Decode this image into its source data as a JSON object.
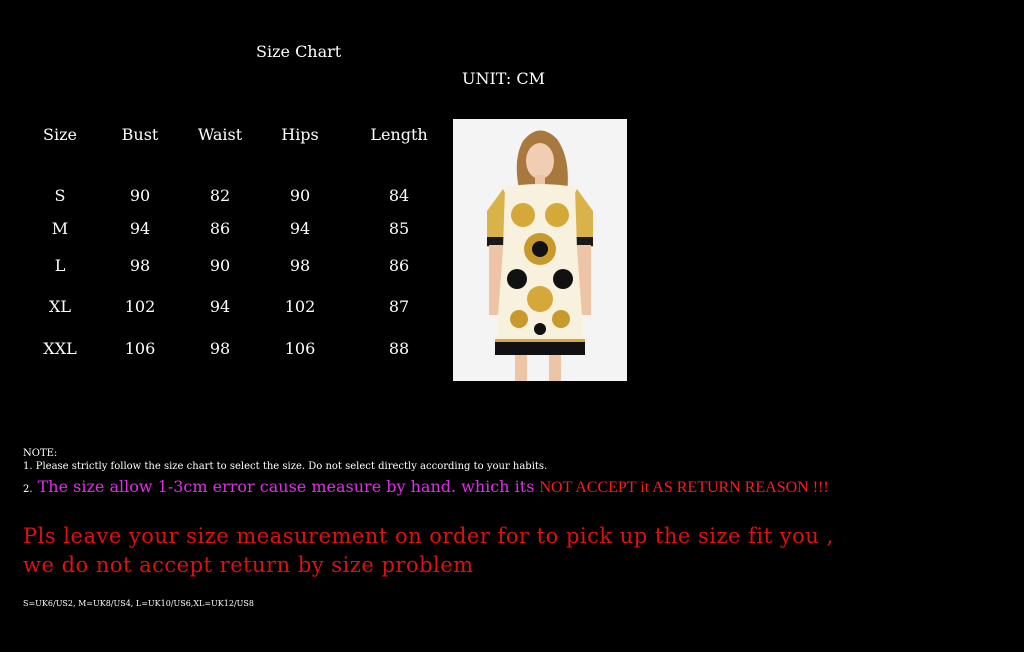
{
  "title": "Size Chart",
  "unit": "UNIT: CM",
  "table": {
    "headers": [
      "Size",
      "Bust",
      "Waist",
      "Hips",
      "Length"
    ],
    "rows": [
      [
        "S",
        "90",
        "82",
        "90",
        "84"
      ],
      [
        "M",
        "94",
        "86",
        "94",
        "85"
      ],
      [
        "L",
        "98",
        "90",
        "98",
        "86"
      ],
      [
        "XL",
        "102",
        "94",
        "102",
        "87"
      ],
      [
        "XXL",
        "106",
        "98",
        "106",
        "88"
      ]
    ]
  },
  "notes": {
    "heading": "NOTE:",
    "note1": "1. Please strictly follow the size chart  to select the size. Do not select directly according to your habits.",
    "note2_num": "2.",
    "note2_part1": " The size allow 1-3cm error cause measure by hand. which its ",
    "note2_part2": "NOT ACCEPT it AS RETURN REASON !!!"
  },
  "message": {
    "line1": "Pls leave your size measurement on order for to pick up the size fit you ,",
    "line2": "we do not accept return by size problem"
  },
  "conversion": "S=UK6/US2,  M=UK8/US4,  L=UK10/US6,XL=UK12/US8",
  "colors": {
    "background": "#000000",
    "text": "#ffffff",
    "magenta": "#e22de8",
    "red": "#ff1a1a"
  }
}
